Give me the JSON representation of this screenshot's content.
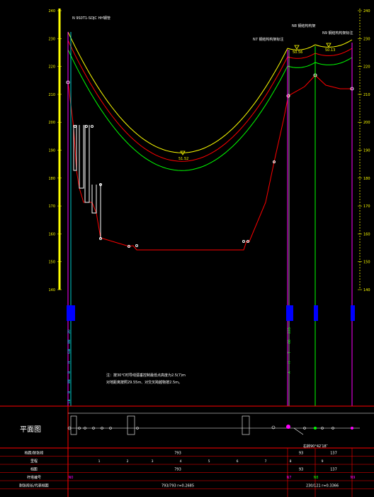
{
  "colors": {
    "background": "#000000",
    "axis": "#ffff00",
    "sag_top": "#ffff00",
    "sag_mid": "#ff0000",
    "sag_low": "#00ff00",
    "ground": "#ff0000",
    "table_lines": "#ff0000",
    "magenta": "#ff00ff",
    "cyan": "#00ffff",
    "white": "#ffffff"
  },
  "profile": {
    "left_axis_ticks": [
      "240",
      "230",
      "220",
      "210",
      "200",
      "190",
      "180",
      "170",
      "160",
      "150",
      "140"
    ],
    "right_axis_ticks": [
      "240",
      "230",
      "220",
      "210",
      "200",
      "190",
      "180",
      "170",
      "160",
      "150",
      "140"
    ],
    "tower_labels": {
      "start": "N  9S0T1-SDJC  HH钢管",
      "mid1": "N7 钢结构构架标注",
      "mid2": "N8 钢结构构架",
      "end": "N9 钢结构构架标注"
    },
    "sag_values": {
      "lowest": "51.52",
      "right1": "50.56",
      "right2": "50.13"
    },
    "note_line1": "注：按30℃时导线弧垂控制最低点高度为2.5(7)m",
    "note_line2": "  对地距离按照29.55m、对交叉跨越物按2.5m。"
  },
  "left_markers": [
    "20",
    "88",
    "GB",
    "H",
    "B",
    "88",
    "B",
    "LB"
  ],
  "right_markers": [
    "22B",
    "88",
    "T",
    "H",
    "A"
  ],
  "plan": {
    "title": "平面图",
    "angle_label": "右转90°42′18″"
  },
  "table": {
    "rows": [
      {
        "label": "档距/耐张段",
        "values": [
          "793",
          "93",
          "137"
        ]
      },
      {
        "label": "里程",
        "values": [
          "1",
          "2",
          "3",
          "4",
          "5",
          "6",
          "7",
          "8",
          "9"
        ]
      },
      {
        "label": "档距",
        "values": [
          "793",
          "93",
          "137"
        ]
      },
      {
        "label": "杆塔编号",
        "values": [
          "N0",
          "N7",
          "N8",
          "N9"
        ]
      },
      {
        "label": "耐张段长/代表档距",
        "values": [
          "793/793  r=0.2685",
          "230/121  r=0.3366"
        ]
      }
    ]
  }
}
